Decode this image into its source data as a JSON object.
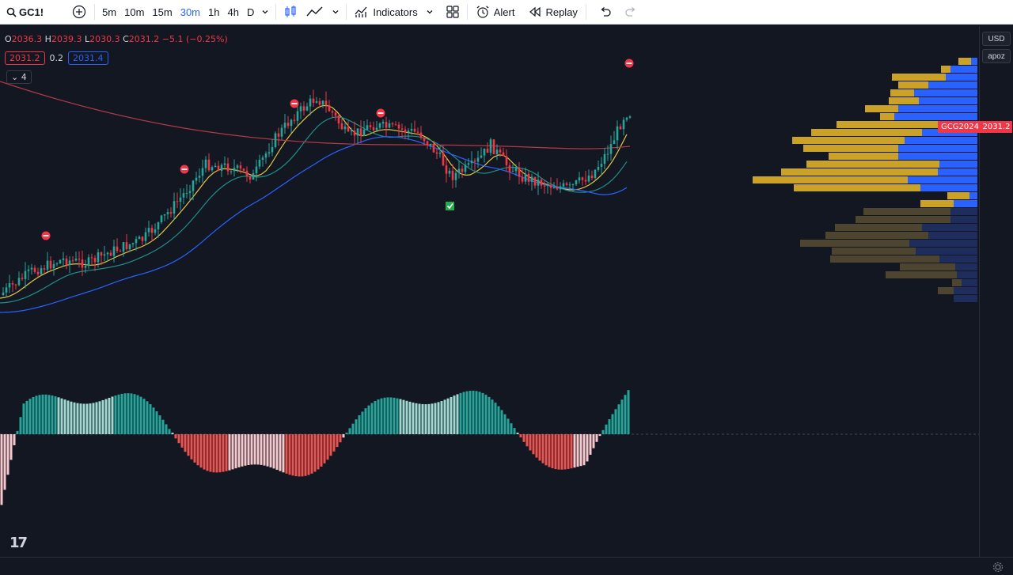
{
  "toolbar": {
    "symbol": "GC1!",
    "intervals": [
      "5m",
      "10m",
      "15m",
      "30m",
      "1h",
      "4h",
      "D"
    ],
    "active_interval": "30m",
    "indicators_label": "Indicators",
    "alert_label": "Alert",
    "replay_label": "Replay"
  },
  "legend": {
    "o_label": "O",
    "o": "2036.3",
    "h_label": "H",
    "h": "2039.3",
    "l_label": "L",
    "l": "2030.3",
    "c_label": "C",
    "c": "2031.2",
    "change": "−5.1 (−0.25%)",
    "ind_value_1": "2031.2",
    "ind_value_2": "0.2",
    "ind_value_3": "2031.4",
    "collapse_count": "4"
  },
  "price_scale": {
    "currency": "USD",
    "mode": "apoz",
    "contract_label": "GCG2024",
    "last_price": "2031.2"
  },
  "colors": {
    "up": "#26a69a",
    "down": "#f23645",
    "ma_yellow": "#e8c547",
    "ma_teal": "#1f8f8a",
    "ma_blue": "#2962ff",
    "ma_red": "#b23a48",
    "vp_up": "#2962ff",
    "vp_down": "#c9a227"
  }
}
